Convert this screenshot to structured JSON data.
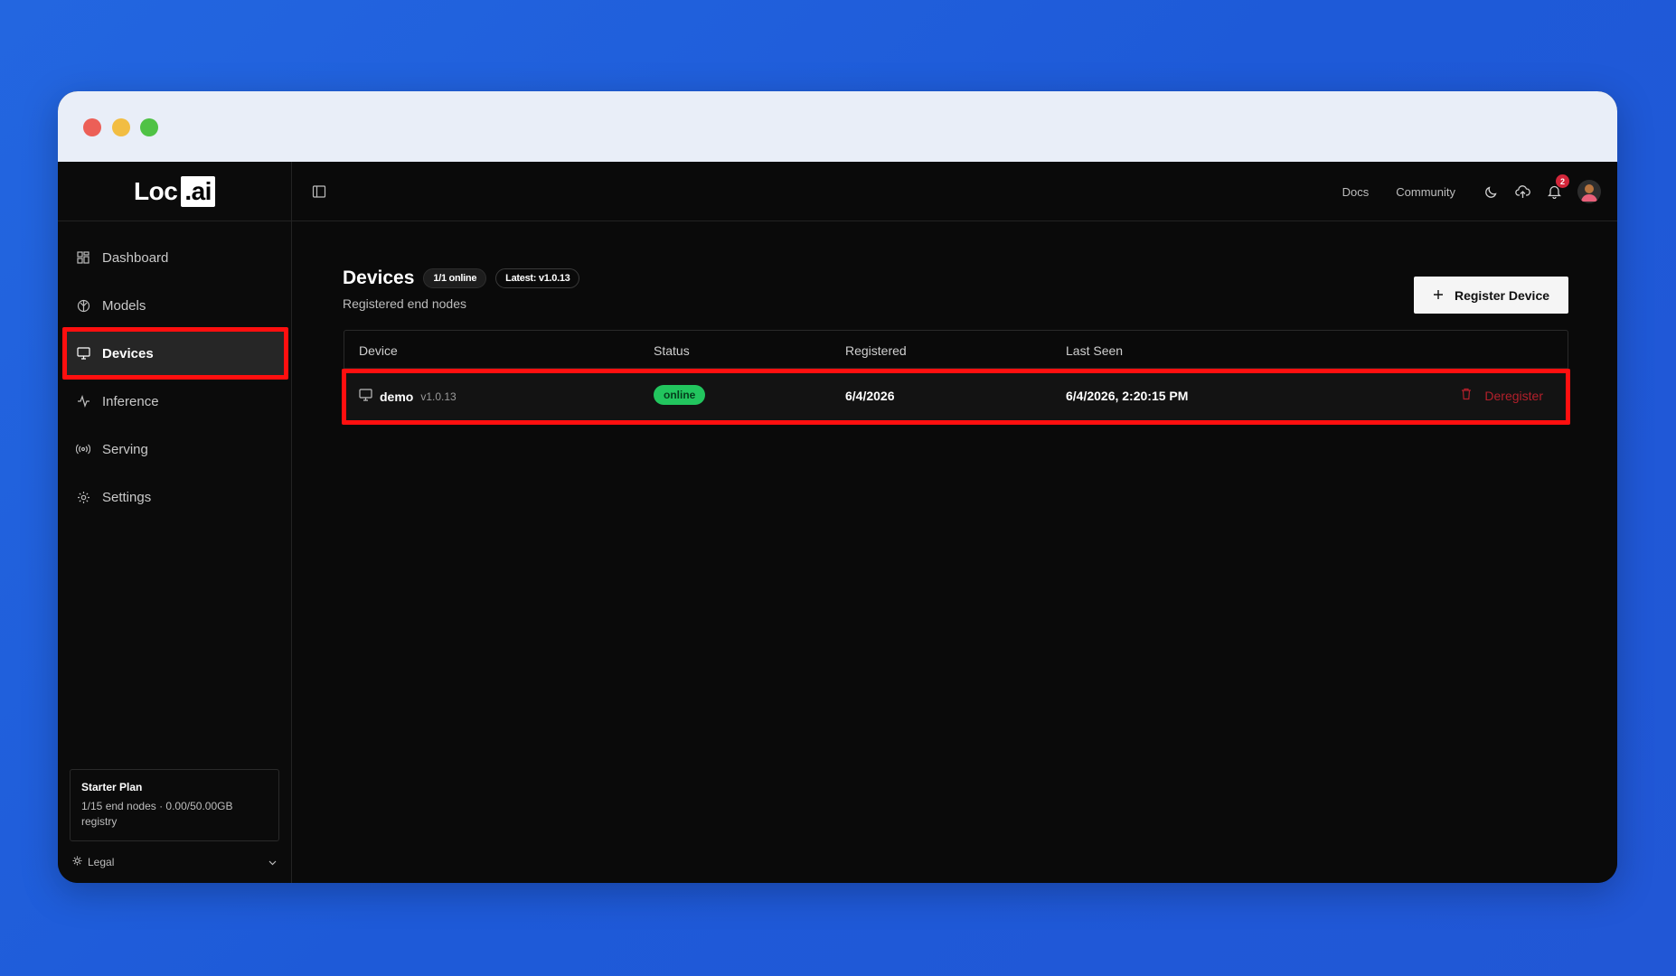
{
  "window": {
    "controls": [
      "close",
      "minimize",
      "maximize"
    ]
  },
  "brand": {
    "logo_text": "Loc",
    "logo_suffix": ".ai"
  },
  "sidebar": {
    "items": [
      {
        "label": "Dashboard",
        "icon": "dashboard-icon"
      },
      {
        "label": "Models",
        "icon": "models-icon"
      },
      {
        "label": "Devices",
        "icon": "monitor-icon",
        "active": true
      },
      {
        "label": "Inference",
        "icon": "activity-icon"
      },
      {
        "label": "Serving",
        "icon": "broadcast-icon"
      },
      {
        "label": "Settings",
        "icon": "gear-icon"
      }
    ],
    "plan": {
      "title": "Starter Plan",
      "desc": "1/15 end nodes · 0.00/50.00GB registry"
    },
    "legal_label": "Legal"
  },
  "topbar": {
    "docs": "Docs",
    "community": "Community",
    "notification_count": "2"
  },
  "page": {
    "title": "Devices",
    "online_pill": "1/1 online",
    "latest_pill": "Latest: v1.0.13",
    "subtitle": "Registered end nodes",
    "register_button": "Register Device"
  },
  "table": {
    "headers": [
      "Device",
      "Status",
      "Registered",
      "Last Seen"
    ],
    "rows": [
      {
        "device": "demo",
        "version": "v1.0.13",
        "status": "online",
        "registered": "6/4/2026",
        "last_seen": "6/4/2026, 2:20:15 PM",
        "action": "Deregister"
      }
    ]
  },
  "colors": {
    "accent_highlight": "#ff0f0f",
    "status_online": "#22c55e",
    "danger": "#b3202b",
    "background": "#0a0a0a"
  }
}
